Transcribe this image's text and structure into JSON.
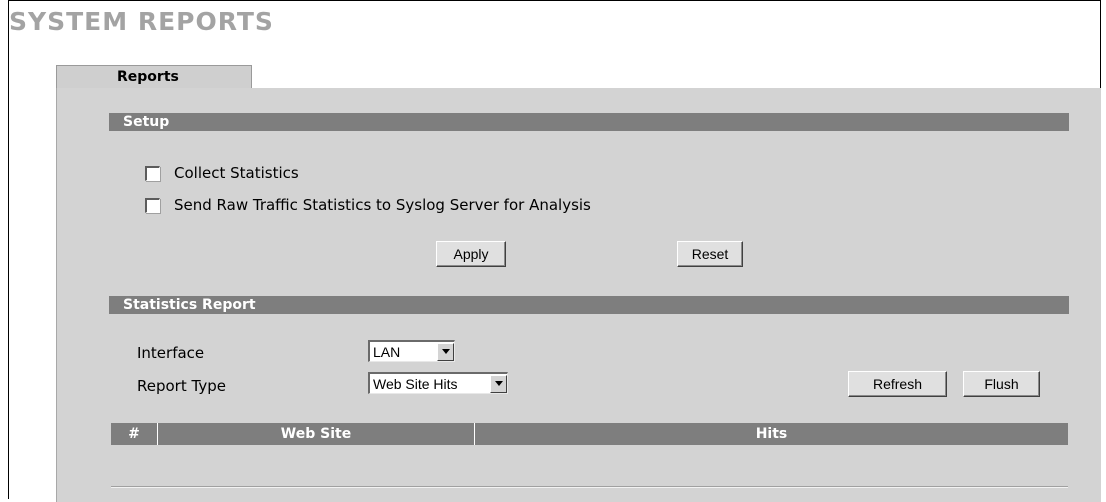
{
  "page": {
    "title": "SYSTEM REPORTS"
  },
  "tabs": [
    {
      "label": "Reports"
    }
  ],
  "setup": {
    "heading": "Setup",
    "collect_statistics": {
      "label": "Collect Statistics",
      "checked": false
    },
    "send_raw": {
      "label": "Send Raw Traffic Statistics to Syslog Server for Analysis",
      "checked": false
    },
    "apply_label": "Apply",
    "reset_label": "Reset"
  },
  "statistics": {
    "heading": "Statistics Report",
    "interface": {
      "label": "Interface",
      "value": "LAN"
    },
    "report_type": {
      "label": "Report Type",
      "value": "Web Site Hits"
    },
    "refresh_label": "Refresh",
    "flush_label": "Flush",
    "table": {
      "columns": [
        "#",
        "Web Site",
        "Hits"
      ],
      "rows": []
    }
  }
}
